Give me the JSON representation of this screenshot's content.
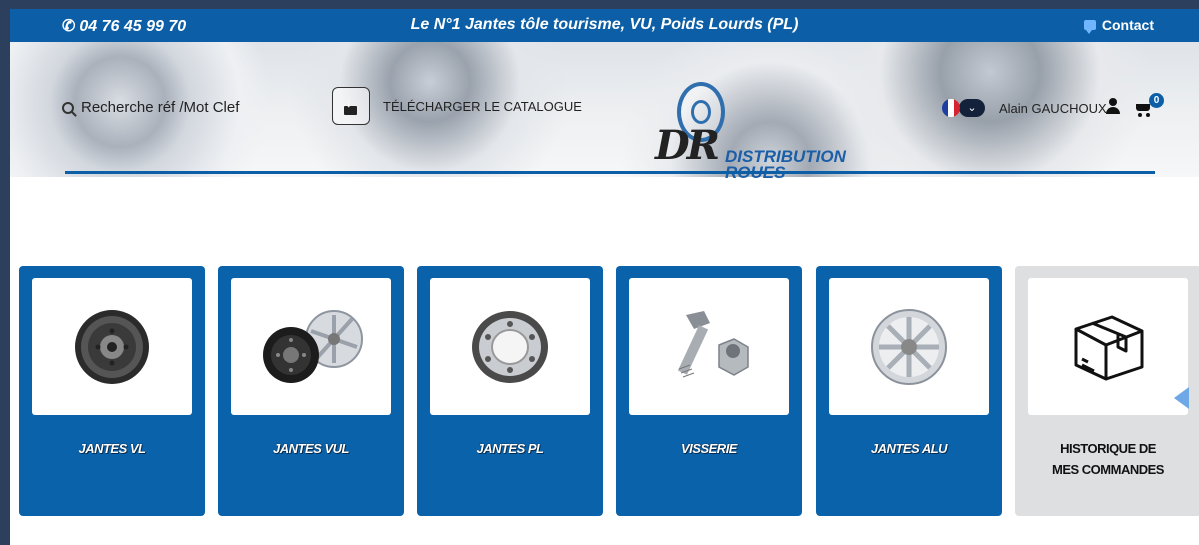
{
  "topbar": {
    "phone": "04 76 45 99 70",
    "tagline": "Le N°1 Jantes tôle tourisme, VU, Poids Lourds (PL)",
    "contact": "Contact"
  },
  "header": {
    "search_label": "Recherche réf /Mot Clef",
    "catalogue_label": "TÉLÉCHARGER LE CATALOGUE",
    "logo_mark": "DR",
    "logo_line1": "DISTRIBUTION",
    "logo_line2": "ROUES",
    "user_name": "Alain GAUCHOUX",
    "cart_count": "0"
  },
  "categories": [
    {
      "label": "JANTES VL",
      "icon": "steel-wheel-icon"
    },
    {
      "label": "JANTES VUL",
      "icon": "steel-and-alloy-wheel-icon"
    },
    {
      "label": "JANTES PL",
      "icon": "truck-wheel-icon"
    },
    {
      "label": "VISSERIE",
      "icon": "wheel-bolt-icon"
    },
    {
      "label": "JANTES ALU",
      "icon": "alloy-wheel-icon"
    },
    {
      "label_line1": "HISTORIQUE DE",
      "label_line2": "MES COMMANDES",
      "icon": "box-icon"
    }
  ],
  "colors": {
    "brand_blue": "#0c5fa6",
    "card_blue": "#0a62ab",
    "history_grey": "#dedfe0",
    "outer_bg": "#2c3f5c"
  }
}
